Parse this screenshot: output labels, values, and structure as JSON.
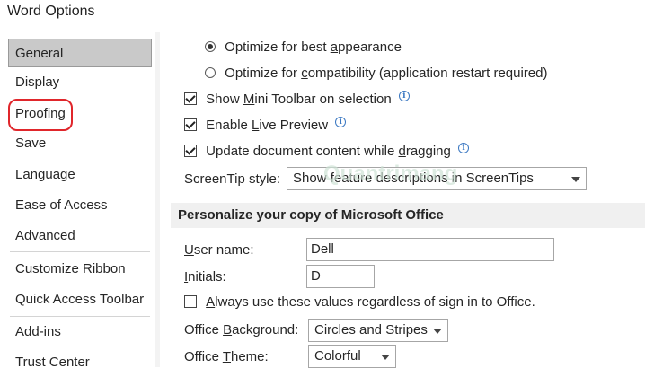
{
  "window": {
    "title": "Word Options"
  },
  "sidebar": {
    "items": [
      {
        "label": "General",
        "selected": true
      },
      {
        "label": "Display"
      },
      {
        "label": "Proofing",
        "highlighted": true
      },
      {
        "label": "Save"
      },
      {
        "label": "Language"
      },
      {
        "label": "Ease of Access"
      },
      {
        "label": "Advanced"
      },
      {
        "label": "Customize Ribbon"
      },
      {
        "label": "Quick Access Toolbar"
      },
      {
        "label": "Add-ins"
      },
      {
        "label": "Trust Center"
      }
    ],
    "highlight_color": "#e0262b"
  },
  "options": {
    "radio_best": {
      "pre": "Optimize for best ",
      "u": "a",
      "post": "ppearance",
      "checked": true
    },
    "radio_compat": {
      "pre": "Optimize for ",
      "u": "c",
      "post": "ompatibility (application restart required)",
      "checked": false
    },
    "mini_toolbar": {
      "pre": "Show ",
      "u": "M",
      "post": "ini Toolbar on selection",
      "checked": true
    },
    "live_preview": {
      "pre": "Enable ",
      "u": "L",
      "post": "ive Preview",
      "checked": true
    },
    "update_drag": {
      "pre": "Update document content while ",
      "u": "d",
      "post": "ragging",
      "checked": true
    },
    "screentip_label": "ScreenTip style:",
    "screentip_value": "Show feature descriptions in ScreenTips"
  },
  "personalize": {
    "header": "Personalize your copy of Microsoft Office",
    "username_label_u": "U",
    "username_label_rest": "ser name:",
    "username_value": "Dell",
    "initials_label_u": "I",
    "initials_label_rest": "nitials:",
    "initials_value": "D",
    "always_use": {
      "pre": "",
      "u": "A",
      "post": "lways use these values regardless of sign in to Office.",
      "checked": false
    },
    "background_label_pre": "Office ",
    "background_label_u": "B",
    "background_label_post": "ackground:",
    "background_value": "Circles and Stripes",
    "theme_label_pre": "Office ",
    "theme_label_u": "T",
    "theme_label_post": "heme:",
    "theme_value": "Colorful"
  },
  "watermark": {
    "text": "Quantrimang"
  },
  "icons": {
    "info": "info-icon",
    "caret": "chevron-down-icon"
  }
}
